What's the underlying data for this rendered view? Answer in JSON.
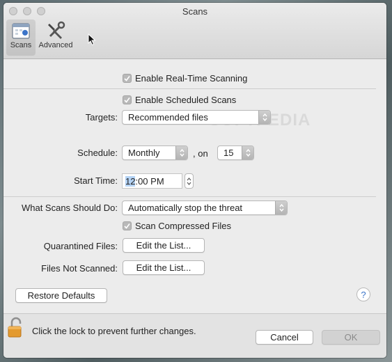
{
  "window": {
    "title": "Scans"
  },
  "toolbar": {
    "scans_label": "Scans",
    "advanced_label": "Advanced"
  },
  "realtime": {
    "label": "Enable Real-Time Scanning",
    "checked": true
  },
  "scheduled": {
    "label": "Enable Scheduled Scans",
    "checked": true
  },
  "targets": {
    "label": "Targets:",
    "value": "Recommended files"
  },
  "schedule": {
    "label": "Schedule:",
    "value": "Monthly",
    "on_label": ", on",
    "day_value": "15"
  },
  "start_time": {
    "label": "Start Time:",
    "hour_selected": "12",
    "rest": ":00 PM"
  },
  "what_scans": {
    "label": "What Scans Should Do:",
    "value": "Automatically stop the threat"
  },
  "compressed": {
    "label": "Scan Compressed Files",
    "checked": true
  },
  "quarantined": {
    "label": "Quarantined Files:",
    "button": "Edit the List..."
  },
  "not_scanned": {
    "label": "Files Not Scanned:",
    "button": "Edit the List..."
  },
  "restore_button": "Restore Defaults",
  "help_glyph": "?",
  "lock_text": "Click the lock to prevent further changes.",
  "cancel_button": "Cancel",
  "ok_button": "OK",
  "watermark": "SOFTPEDIA",
  "colors": {
    "accent_selection": "#b4d3f5",
    "help_blue": "#3b74c8"
  }
}
